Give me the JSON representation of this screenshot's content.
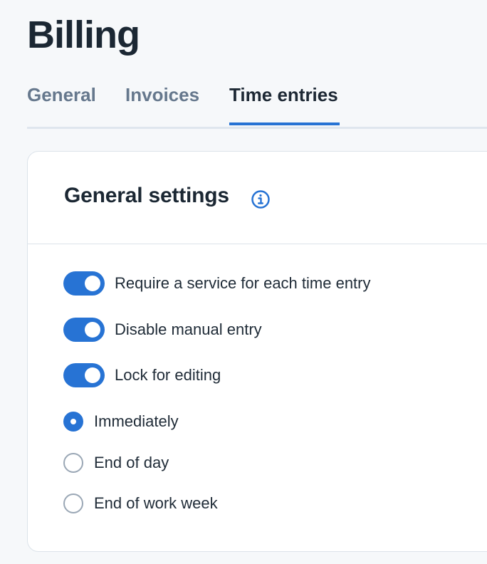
{
  "page": {
    "title": "Billing"
  },
  "tabs": [
    {
      "label": "General",
      "active": false
    },
    {
      "label": "Invoices",
      "active": false
    },
    {
      "label": "Time entries",
      "active": true
    }
  ],
  "settings": {
    "title": "General settings",
    "info_icon": "info-icon",
    "toggles": [
      {
        "label": "Require a service for each time entry",
        "on": true
      },
      {
        "label": "Disable manual entry",
        "on": true
      },
      {
        "label": "Lock for editing",
        "on": true
      }
    ],
    "lock_options": [
      {
        "label": "Immediately",
        "selected": true
      },
      {
        "label": "End of day",
        "selected": false
      },
      {
        "label": "End of work week",
        "selected": false
      }
    ]
  },
  "colors": {
    "accent": "#2773d4",
    "text": "#1b2733",
    "muted_tab": "#66788d",
    "border": "#dce3ea",
    "page_bg": "#f6f8fa"
  }
}
